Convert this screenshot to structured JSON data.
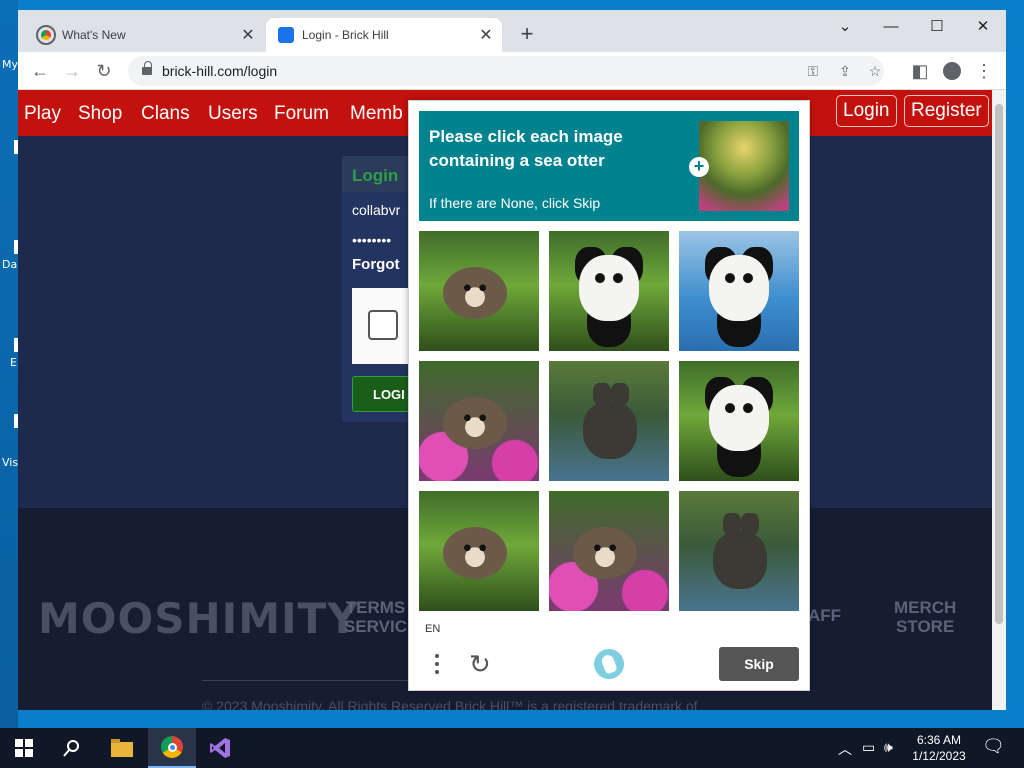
{
  "desktop": {
    "labels": [
      "My",
      "Da",
      "E",
      "Vis"
    ]
  },
  "browser": {
    "tabs": [
      {
        "title": "What's New",
        "close": "✕"
      },
      {
        "title": "Login - Brick Hill",
        "close": "✕"
      }
    ],
    "new_tab": "+",
    "url": "brick-hill.com/login",
    "window_controls": {
      "dropdown": "⌄",
      "minimize": "—",
      "maximize": "☐",
      "close": "✕"
    }
  },
  "site": {
    "nav": [
      "Play",
      "Shop",
      "Clans",
      "Users",
      "Forum",
      "Memb"
    ],
    "login_nav": "Login",
    "register_nav": "Register",
    "login_box": {
      "header": "Login",
      "username": "collabvr",
      "password": "••••••••",
      "forgot": "Forgot",
      "login_button": "LOGI"
    },
    "footer": {
      "logo": "MOOSHIMITY",
      "links": [
        [
          "TERMS",
          "SERVIC"
        ],
        [
          "AFF",
          ""
        ],
        [
          "MERCH",
          "STORE"
        ]
      ],
      "copyright": "© 2023 Mooshimity. All Rights Reserved Brick Hill™ is a registered trademark of"
    }
  },
  "captcha": {
    "title": "Please click each image containing a sea otter",
    "subtitle": "If there are None, click Skip",
    "tiles": [
      {
        "content": "sea otter",
        "scene": "grass"
      },
      {
        "content": "panda",
        "scene": "grass"
      },
      {
        "content": "panda",
        "scene": "water"
      },
      {
        "content": "sea otter",
        "scene": "flowers"
      },
      {
        "content": "rabbit",
        "scene": "pond"
      },
      {
        "content": "panda",
        "scene": "grass"
      },
      {
        "content": "sea otter",
        "scene": "grass"
      },
      {
        "content": "sea otter",
        "scene": "flowers"
      },
      {
        "content": "rabbit",
        "scene": "pond"
      }
    ],
    "language": "EN",
    "skip_label": "Skip"
  },
  "taskbar": {
    "time": "6:36 AM",
    "date": "1/12/2023"
  },
  "colors": {
    "nav_red": "#c3110d",
    "captcha_teal": "#00838f",
    "page_bg": "#1d2a4e"
  }
}
